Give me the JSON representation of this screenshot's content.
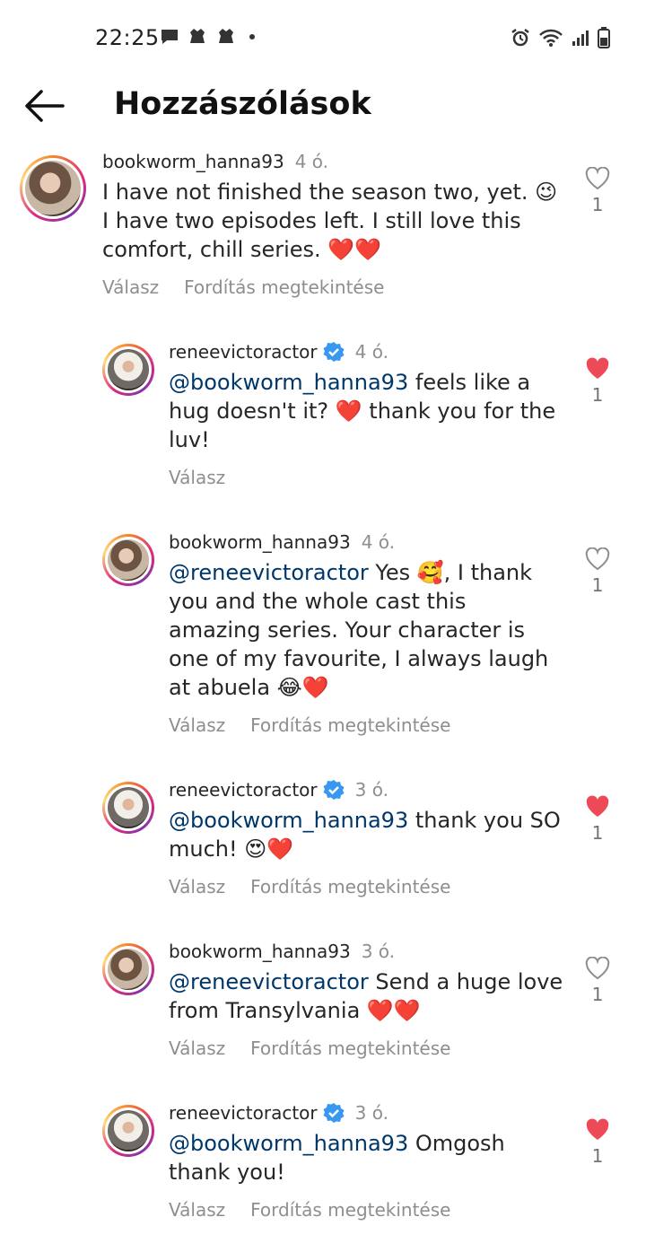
{
  "status": {
    "time": "22:25"
  },
  "header": {
    "title": "Hozzászólások"
  },
  "labels": {
    "reply": "Válasz",
    "translate": "Fordítás megtekintése"
  },
  "colors": {
    "like_red": "#ed4956",
    "verified_blue": "#3897f0",
    "mention": "#00376b"
  },
  "comments": [
    {
      "username": "bookworm_hanna93",
      "time": "4 ó.",
      "verified": false,
      "liked": false,
      "likes": "1",
      "text": "I have not finished the season two, yet. 😉 I have two episodes left. I still love this comfort, chill series. ❤️❤️",
      "mention": "",
      "show_translate": true
    },
    {
      "username": "reneevictoractor",
      "time": "4 ó.",
      "verified": true,
      "liked": true,
      "likes": "1",
      "mention": "@bookworm_hanna93",
      "text": " feels like a hug doesn't it? ❤️ thank you for  the luv!",
      "show_translate": false
    },
    {
      "username": "bookworm_hanna93",
      "time": "4 ó.",
      "verified": false,
      "liked": false,
      "likes": "1",
      "mention": "@reneevictoractor",
      "text": " Yes 🥰, I thank you and the whole cast this amazing series. Your character is one of my favourite, I always laugh at abuela 😂❤️",
      "show_translate": true
    },
    {
      "username": "reneevictoractor",
      "time": "3 ó.",
      "verified": true,
      "liked": true,
      "likes": "1",
      "mention": "@bookworm_hanna93",
      "text": " thank you SO much! 😍❤️",
      "show_translate": true
    },
    {
      "username": "bookworm_hanna93",
      "time": "3 ó.",
      "verified": false,
      "liked": false,
      "likes": "1",
      "mention": "@reneevictoractor",
      "text": " Send a huge love from Transylvania ❤️❤️",
      "show_translate": true
    },
    {
      "username": "reneevictoractor",
      "time": "3 ó.",
      "verified": true,
      "liked": true,
      "likes": "1",
      "mention": "@bookworm_hanna93",
      "text": " Omgosh thank you!",
      "show_translate": true
    }
  ]
}
